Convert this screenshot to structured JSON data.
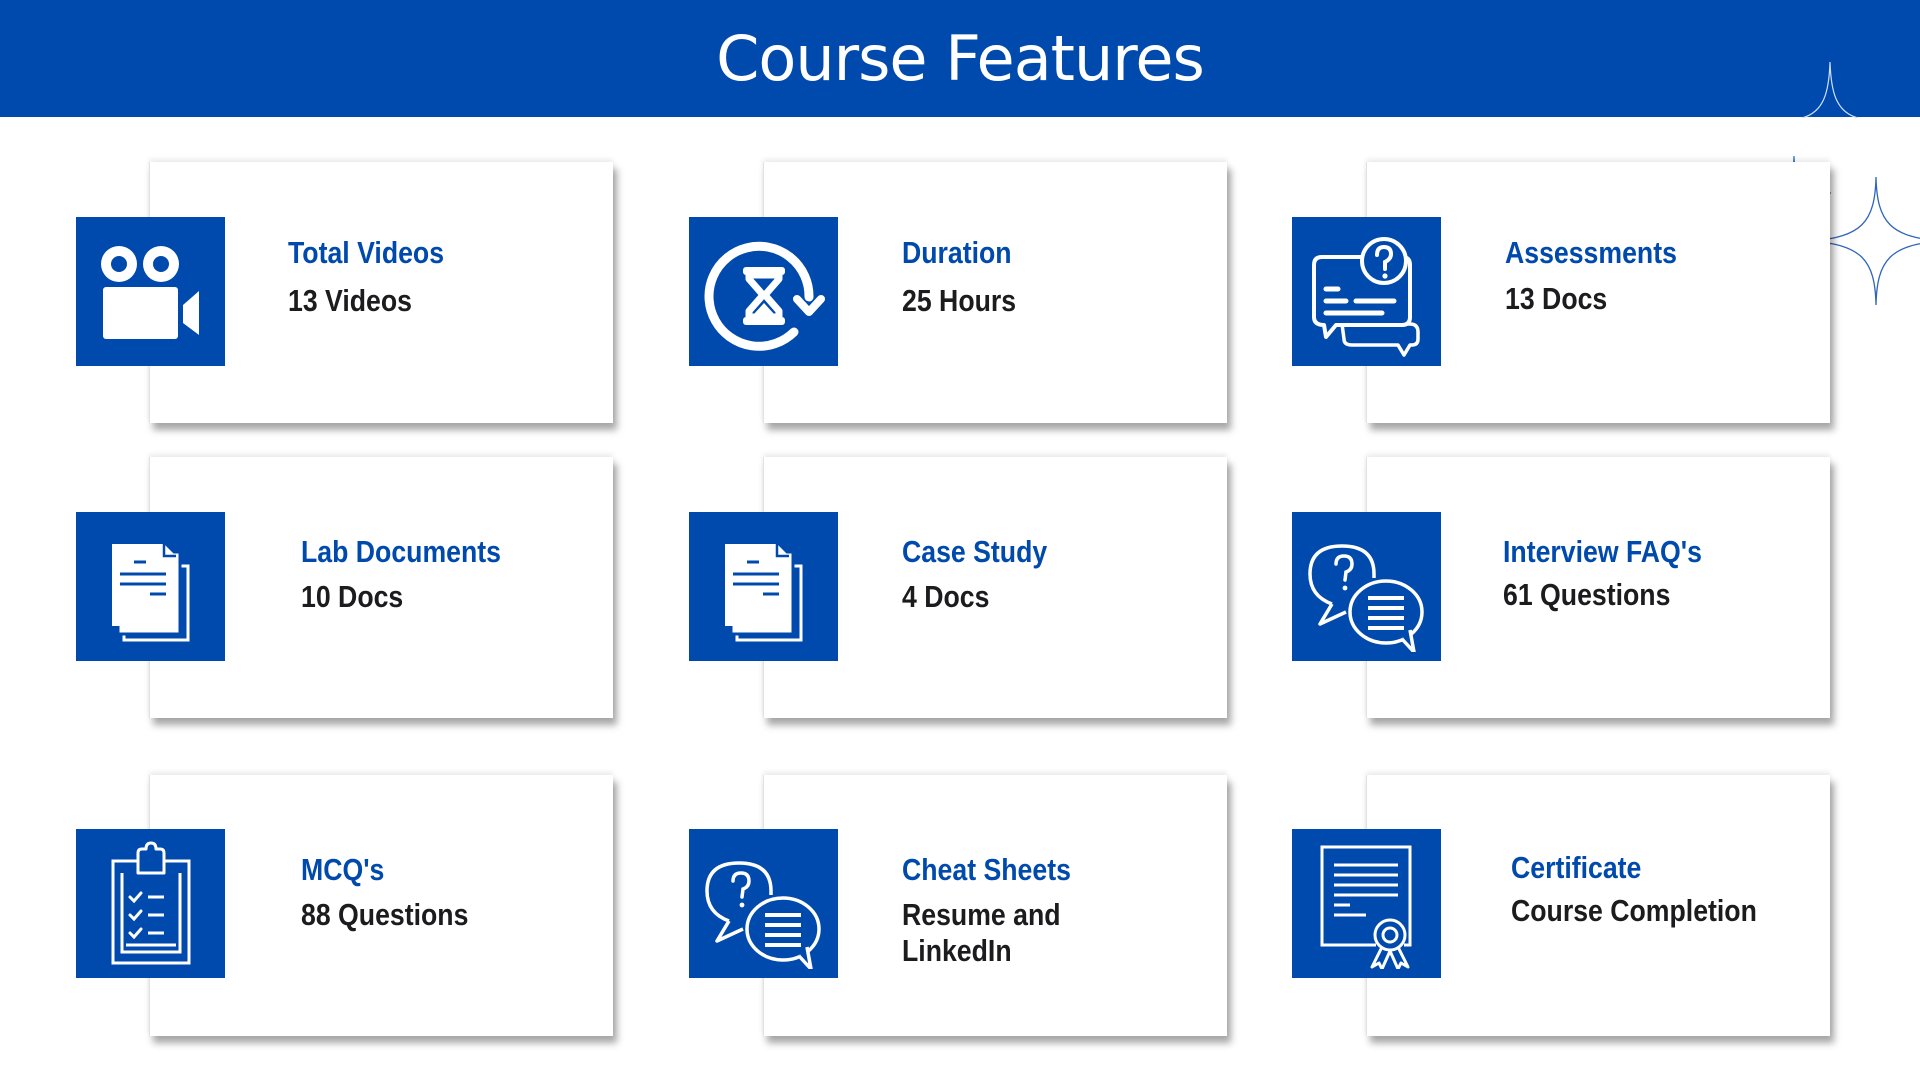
{
  "header": {
    "title": "Course Features"
  },
  "colors": {
    "brand_blue": "#004aad",
    "value_text": "#1c1c1e"
  },
  "features": [
    {
      "title": "Total Videos",
      "value": "13 Videos",
      "icon": "video-camera-icon"
    },
    {
      "title": "Duration",
      "value": "25 Hours",
      "icon": "hourglass-refresh-icon"
    },
    {
      "title": "Assessments",
      "value": "13 Docs",
      "icon": "question-chat-icon"
    },
    {
      "title": "Lab Documents",
      "value": "10 Docs",
      "icon": "documents-icon"
    },
    {
      "title": "Case Study",
      "value": "4 Docs",
      "icon": "documents-icon"
    },
    {
      "title": "Interview FAQ's",
      "value": "61 Questions",
      "icon": "faq-chat-bubbles-icon"
    },
    {
      "title": "MCQ's",
      "value": "88 Questions",
      "icon": "clipboard-checklist-icon"
    },
    {
      "title": "Cheat Sheets",
      "value": "Resume and\nLinkedIn",
      "icon": "faq-chat-bubbles-icon"
    },
    {
      "title": "Certificate",
      "value": "Course Completion",
      "icon": "certificate-icon"
    }
  ]
}
